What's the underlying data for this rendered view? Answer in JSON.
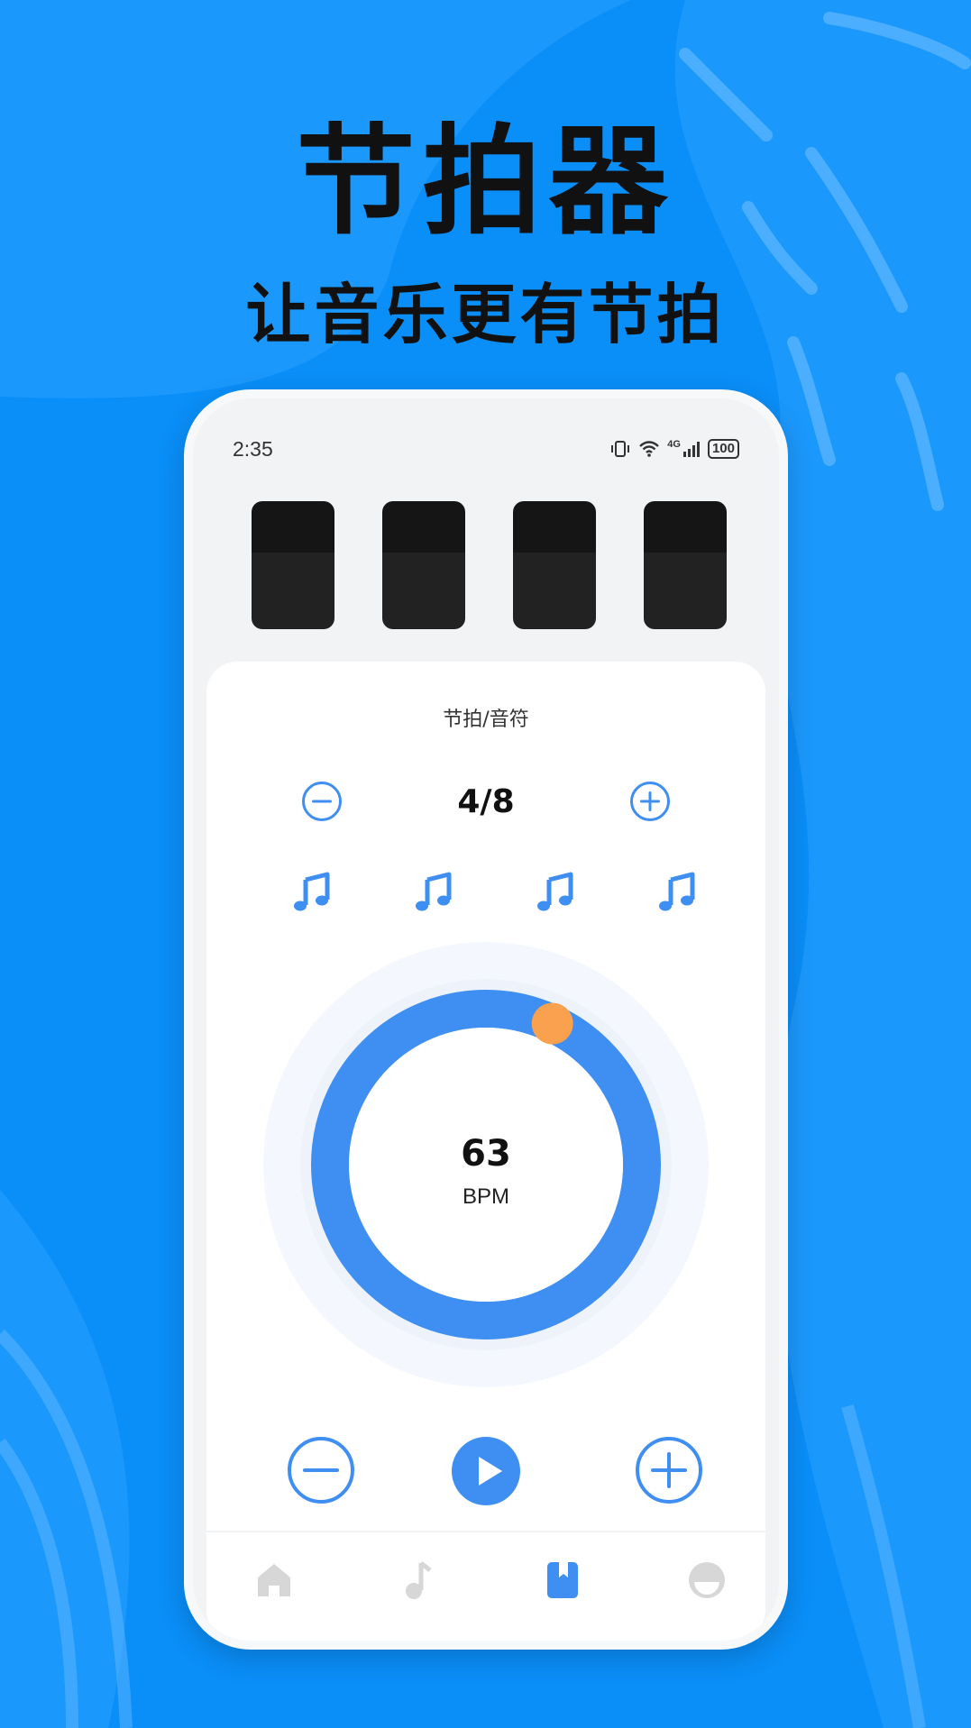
{
  "promo": {
    "title": "节拍器",
    "subtitle": "让音乐更有节拍"
  },
  "status_bar": {
    "time": "2:35",
    "network": "4G",
    "battery": "100"
  },
  "pads": {
    "count": 4
  },
  "metronome": {
    "section_label": "节拍/音符",
    "time_signature": "4/8",
    "beat_notes": [
      "music-note-icon",
      "music-note-icon",
      "music-note-icon",
      "music-note-icon"
    ],
    "bpm_value": "63",
    "bpm_unit": "BPM",
    "dial_position_fraction": 0.07
  },
  "tabs": [
    {
      "name": "home",
      "icon": "home-icon",
      "active": false
    },
    {
      "name": "music",
      "icon": "music-note-icon",
      "active": false
    },
    {
      "name": "metronome",
      "icon": "bookmark-book-icon",
      "active": true
    },
    {
      "name": "profile",
      "icon": "profile-face-icon",
      "active": false
    }
  ],
  "colors": {
    "background": "#0a8ef8",
    "accent": "#3f8ef2",
    "knob": "#f9a14e",
    "tab_inactive": "#d7d7d7"
  }
}
